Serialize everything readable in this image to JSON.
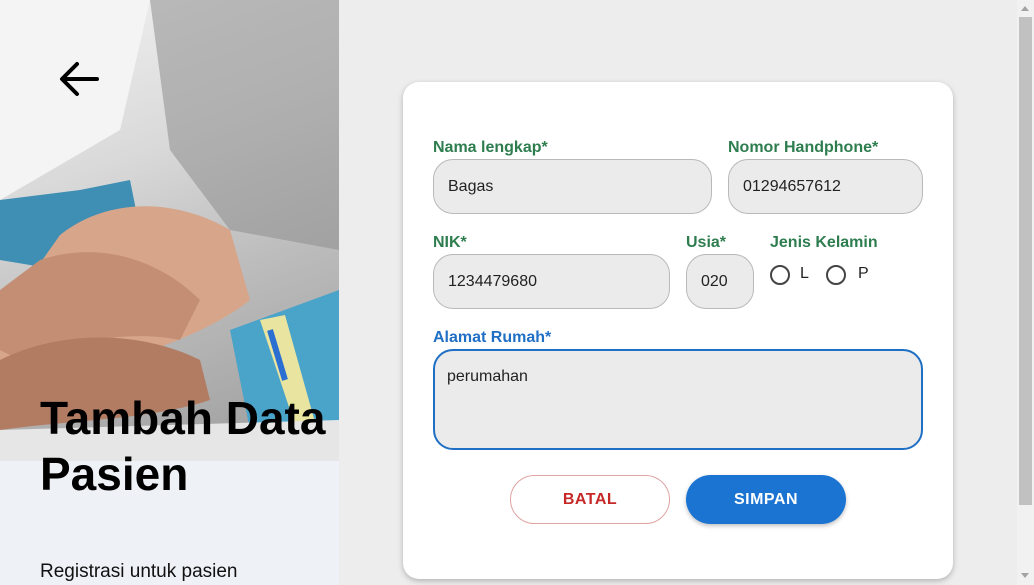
{
  "hero": {
    "title": "Tambah Data Pasien",
    "subtitle": "Registrasi untuk pasien",
    "back_icon": "arrow-left-icon"
  },
  "form": {
    "name": {
      "label": "Nama lengkap*",
      "value": "Bagas"
    },
    "phone": {
      "label": "Nomor Handphone*",
      "value": "01294657612"
    },
    "nik": {
      "label": "NIK*",
      "value": "1234479680"
    },
    "age": {
      "label": "Usia*",
      "value": "020"
    },
    "gender": {
      "label": "Jenis Kelamin",
      "options": [
        "L",
        "P"
      ],
      "selected": ""
    },
    "address": {
      "label": "Alamat Rumah*",
      "value": "perumahan"
    }
  },
  "actions": {
    "cancel_label": "BATAL",
    "save_label": "SIMPAN"
  },
  "colors": {
    "label_green": "#2e7d4f",
    "focus_blue": "#1f6fc5",
    "save_blue": "#1b74d1",
    "cancel_red": "#c62828"
  }
}
